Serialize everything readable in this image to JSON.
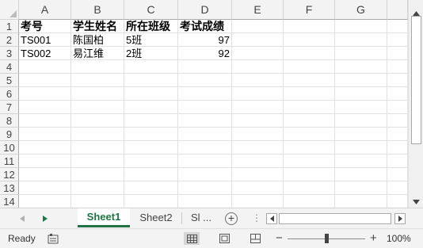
{
  "grid": {
    "columns": [
      "A",
      "B",
      "C",
      "D",
      "E",
      "F",
      "G"
    ],
    "rows": [
      "1",
      "2",
      "3",
      "4",
      "5",
      "6",
      "7",
      "8",
      "9",
      "10",
      "11",
      "12",
      "13",
      "14"
    ],
    "cells": [
      [
        "考号",
        "学生姓名",
        "所在班级",
        "考试成绩"
      ],
      [
        "TS001",
        "陈国柏",
        "5班",
        "97"
      ],
      [
        "TS002",
        "易江维",
        "2班",
        "92"
      ]
    ]
  },
  "tabs": {
    "items": [
      "Sheet1",
      "Sheet2",
      "Sl ..."
    ],
    "active_index": 0,
    "add_label": "+",
    "more_glyph": "⋮"
  },
  "statusbar": {
    "ready": "Ready",
    "zoom_minus": "−",
    "zoom_plus": "+",
    "zoom_percent": "100%"
  },
  "colors": {
    "accent": "#217346",
    "header_bg": "#f3f3f3",
    "gridline": "#e1e1e1"
  },
  "icons": {
    "tab_nav_prev": "triangle-left-icon",
    "tab_nav_next": "triangle-right-icon",
    "accessibility": "accessibility-icon",
    "normal_view": "normal-view-icon",
    "page_layout_view": "page-layout-view-icon",
    "page_break_view": "page-break-preview-icon"
  }
}
